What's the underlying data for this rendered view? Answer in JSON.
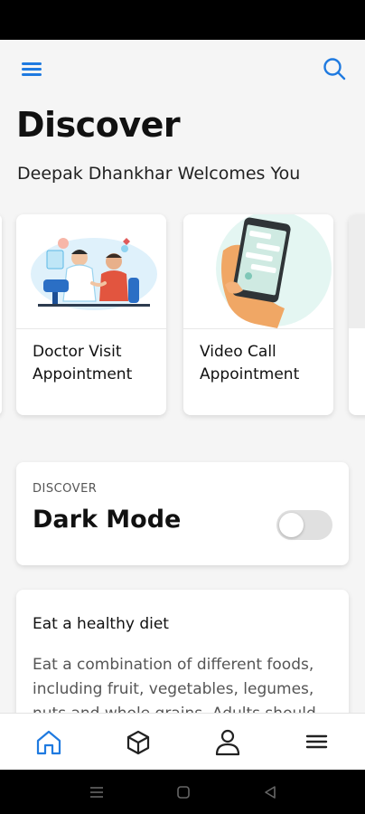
{
  "header": {
    "menu_icon": "hamburger-menu-icon",
    "search_icon": "search-icon",
    "accent_color": "#1f7ae0"
  },
  "page": {
    "title": "Discover",
    "subtitle": "Deepak Dhankhar Welcomes You"
  },
  "appointments": [
    {
      "label": "Doctor Visit Appointment",
      "illustration": "doctor-patient-illustration"
    },
    {
      "label": "Video Call Appointment",
      "illustration": "phone-in-hand-illustration"
    }
  ],
  "dark_mode": {
    "eyebrow": "DISCOVER",
    "title": "Dark Mode",
    "enabled": false
  },
  "tip": {
    "title": "Eat a healthy diet",
    "body": "Eat a combination of different foods, including fruit, vegetables, legumes, nuts and whole grains. Adults should"
  },
  "bottom_nav": [
    {
      "icon": "home-icon",
      "active": true
    },
    {
      "icon": "box-icon",
      "active": false
    },
    {
      "icon": "profile-icon",
      "active": false
    },
    {
      "icon": "menu-icon",
      "active": false
    }
  ],
  "system_nav": [
    "recents-icon",
    "home-square-icon",
    "back-triangle-icon"
  ]
}
